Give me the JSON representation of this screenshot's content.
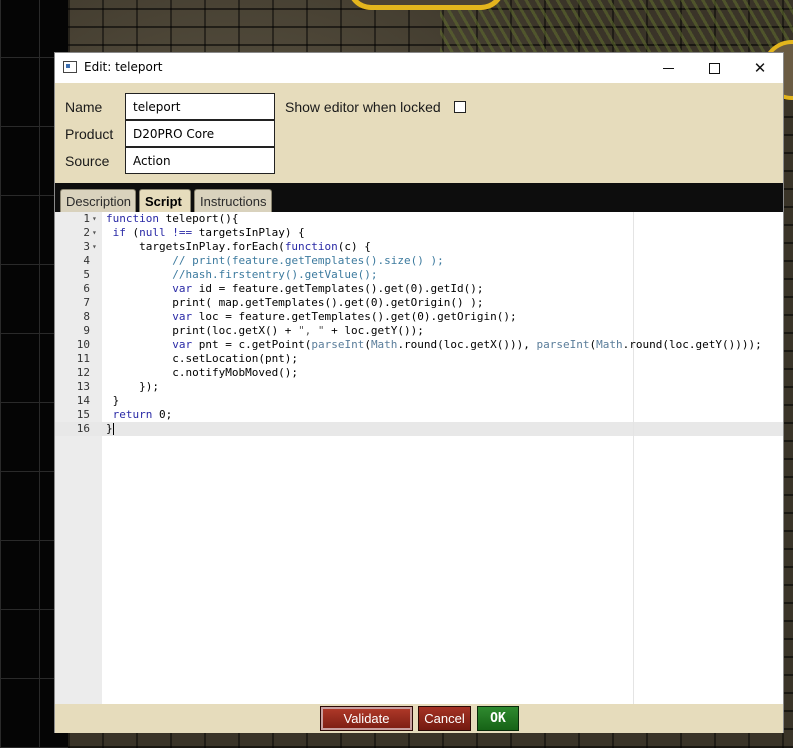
{
  "window": {
    "title": "Edit: teleport"
  },
  "properties": {
    "name_label": "Name",
    "name_value": "teleport",
    "product_label": "Product",
    "product_value": "D20PRO Core",
    "source_label": "Source",
    "source_value": "Action",
    "show_editor_label": "Show editor when locked",
    "show_editor_checked": false
  },
  "tabs": [
    {
      "label": "Description",
      "active": false
    },
    {
      "label": "Script",
      "active": true
    },
    {
      "label": "Instructions",
      "active": false
    }
  ],
  "editor": {
    "active_line": 16,
    "lines": [
      {
        "n": "1",
        "fold": "▾",
        "html": "<span class=\"kw\">function</span> teleport(){"
      },
      {
        "n": "2",
        "fold": "▾",
        "html": " <span class=\"kw\">if</span> (<span class=\"kw\">null</span> <span class=\"kw\">!==</span> targetsInPlay) {"
      },
      {
        "n": "3",
        "fold": "▾",
        "html": "     targetsInPlay.forEach(<span class=\"kw\">function</span>(c) {"
      },
      {
        "n": "4",
        "fold": "",
        "html": "          <span class=\"cm\">// print(feature.getTemplates().size() );</span>"
      },
      {
        "n": "5",
        "fold": "",
        "html": "          <span class=\"cm\">//hash.firstentry().getValue();</span>"
      },
      {
        "n": "6",
        "fold": "",
        "html": "          <span class=\"kw\">var</span> id = feature.getTemplates().get(0).getId();"
      },
      {
        "n": "7",
        "fold": "",
        "html": "          print( map.getTemplates().get(0).getOrigin() );"
      },
      {
        "n": "8",
        "fold": "",
        "html": "          <span class=\"kw\">var</span> loc = feature.getTemplates().get(0).getOrigin();"
      },
      {
        "n": "9",
        "fold": "",
        "html": "          print(loc.getX() + <span class=\"str\">\", \"</span> + loc.getY());"
      },
      {
        "n": "10",
        "fold": "",
        "html": "          <span class=\"kw\">var</span> pnt = c.getPoint(<span class=\"fn\">parseInt</span>(<span class=\"fn\">Math</span>.round(loc.getX())), <span class=\"fn\">parseInt</span>(<span class=\"fn\">Math</span>.round(loc.getY())));"
      },
      {
        "n": "11",
        "fold": "",
        "html": "          c.setLocation(pnt);"
      },
      {
        "n": "12",
        "fold": "",
        "html": "          c.notifyMobMoved();"
      },
      {
        "n": "13",
        "fold": "",
        "html": "     });"
      },
      {
        "n": "14",
        "fold": "",
        "html": " }"
      },
      {
        "n": "15",
        "fold": "",
        "html": " <span class=\"kw\">return</span> 0;"
      },
      {
        "n": "16",
        "fold": "",
        "html": "}"
      }
    ]
  },
  "footer": {
    "validate_label": "Validate",
    "cancel_label": "Cancel",
    "ok_label": "OK"
  },
  "colors": {
    "panel_bg": "#e6dcbc",
    "validate_bg": "#8f2417",
    "ok_bg": "#217321",
    "token_border": "#e3b51d"
  }
}
